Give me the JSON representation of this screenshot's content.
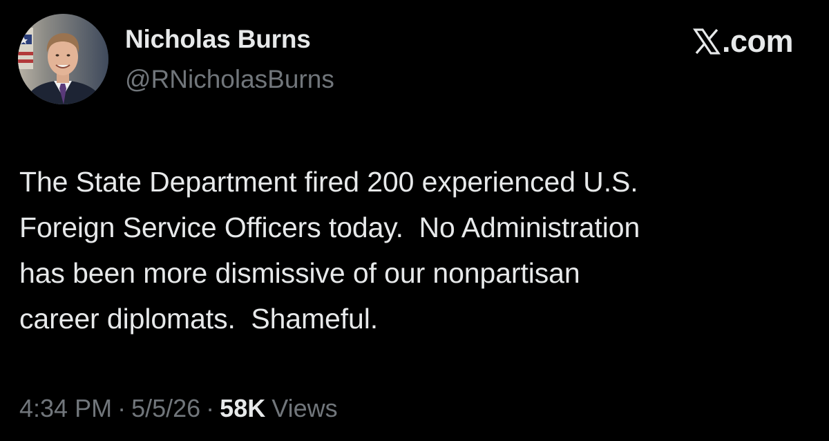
{
  "tweet": {
    "author": {
      "display_name": "Nicholas Burns",
      "handle": "@RNicholasBurns"
    },
    "brand": {
      "text": ".com",
      "logo_icon": "x-logo-icon"
    },
    "text": "The State Department fired 200 experienced U.S.\nForeign Service Officers today.  No Administration\nhas been more dismissive of our nonpartisan\ncareer diplomats.  Shameful.",
    "meta": {
      "time": "4:34 PM",
      "separator": "·",
      "date": "5/5/26",
      "views_count": "58K",
      "views_label": "Views"
    }
  },
  "colors": {
    "background": "#000000",
    "primary_text": "#e7e9ea",
    "secondary_text": "#71767b"
  }
}
